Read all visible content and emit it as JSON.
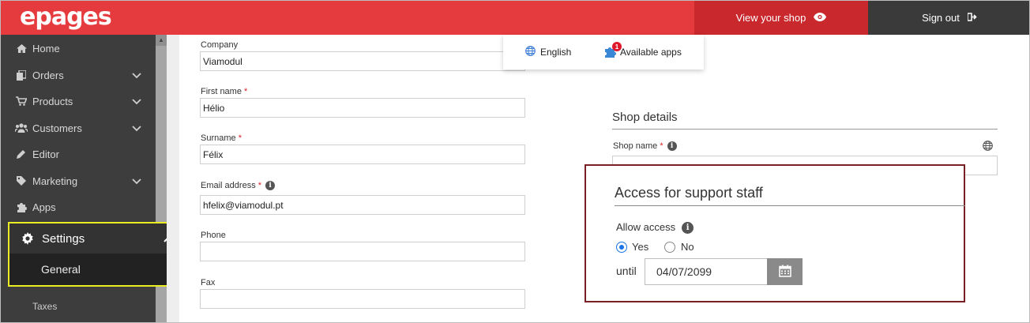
{
  "header": {
    "logo": "epages",
    "view_shop": "View your shop",
    "sign_out": "Sign out"
  },
  "sidebar": {
    "items": [
      {
        "label": "Home",
        "icon": "home-icon"
      },
      {
        "label": "Orders",
        "icon": "orders-icon"
      },
      {
        "label": "Products",
        "icon": "cart-icon"
      },
      {
        "label": "Customers",
        "icon": "users-icon"
      },
      {
        "label": "Editor",
        "icon": "pencil-icon"
      },
      {
        "label": "Marketing",
        "icon": "tag-icon"
      },
      {
        "label": "Apps",
        "icon": "puzzle-icon"
      }
    ],
    "settings": "Settings",
    "general": "General",
    "taxes": "Taxes"
  },
  "toolbar_popup": {
    "language": "English",
    "apps_label": "Available apps",
    "apps_badge": "1"
  },
  "form": {
    "company_label": "Company",
    "company_value": "Viamodul",
    "first_name_label": "First name",
    "first_name_value": "Hélio",
    "surname_label": "Surname",
    "surname_value": "Félix",
    "email_label": "Email address",
    "email_value": "hfelix@viamodul.pt",
    "phone_label": "Phone",
    "phone_value": "",
    "fax_label": "Fax",
    "fax_value": "",
    "required_mark": "*"
  },
  "shop_details": {
    "heading": "Shop details",
    "shop_name_label": "Shop name"
  },
  "support_access": {
    "title": "Access for support staff",
    "allow_label": "Allow access",
    "yes": "Yes",
    "no": "No",
    "selected": "Yes",
    "until_label": "until",
    "until_date": "04/07/2099"
  },
  "colors": {
    "brand_red": "#e63b3e",
    "highlight_yellow": "#ecec24",
    "access_border": "#7a1f24",
    "radio_blue": "#1a73e8"
  }
}
